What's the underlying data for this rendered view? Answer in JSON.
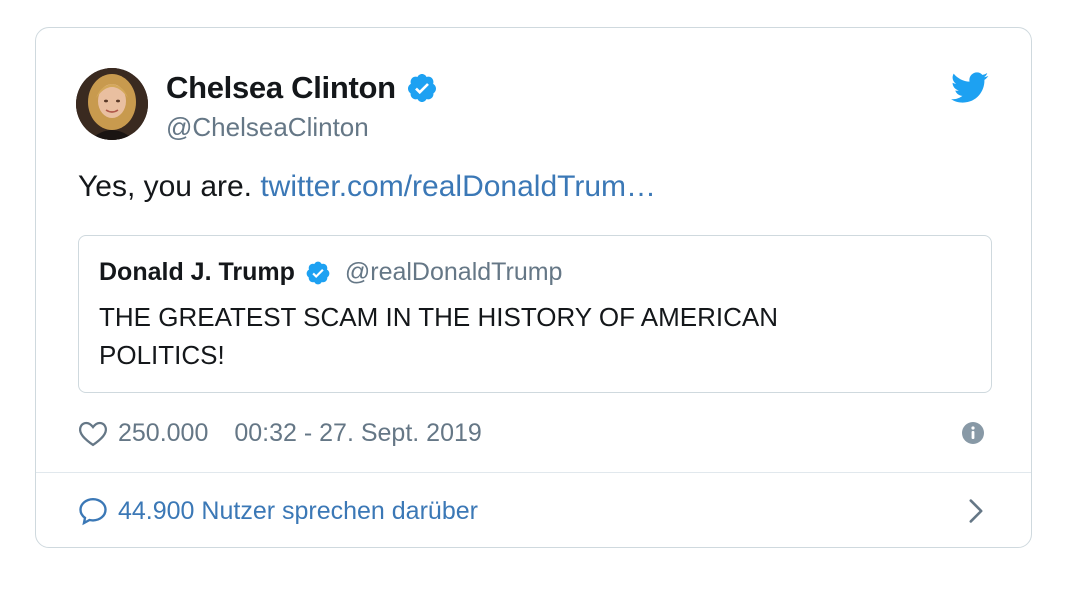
{
  "author": {
    "display_name": "Chelsea Clinton",
    "handle": "@ChelseaClinton",
    "verified": true
  },
  "tweet": {
    "text": "Yes, you are. ",
    "link": "twitter.com/realDonaldTrum…"
  },
  "quoted_tweet": {
    "display_name": "Donald J. Trump",
    "handle": "@realDonaldTrump",
    "verified": true,
    "text": "THE GREATEST SCAM IN THE HISTORY OF AMERICAN POLITICS!"
  },
  "meta": {
    "likes": "250.000",
    "timestamp": "00:32 - 27. Sept. 2019"
  },
  "footer": {
    "conversation_label": "44.900 Nutzer sprechen darüber"
  },
  "colors": {
    "link": "#3b78b6",
    "verified": "#1da1f2",
    "twitter_blue": "#1da1f2",
    "muted": "#657786"
  },
  "icons": {
    "brand": "twitter-bird-icon",
    "verified": "verified-badge-icon",
    "like": "heart-icon",
    "info": "info-icon",
    "conversation": "speech-bubble-icon",
    "more": "chevron-right-icon"
  }
}
